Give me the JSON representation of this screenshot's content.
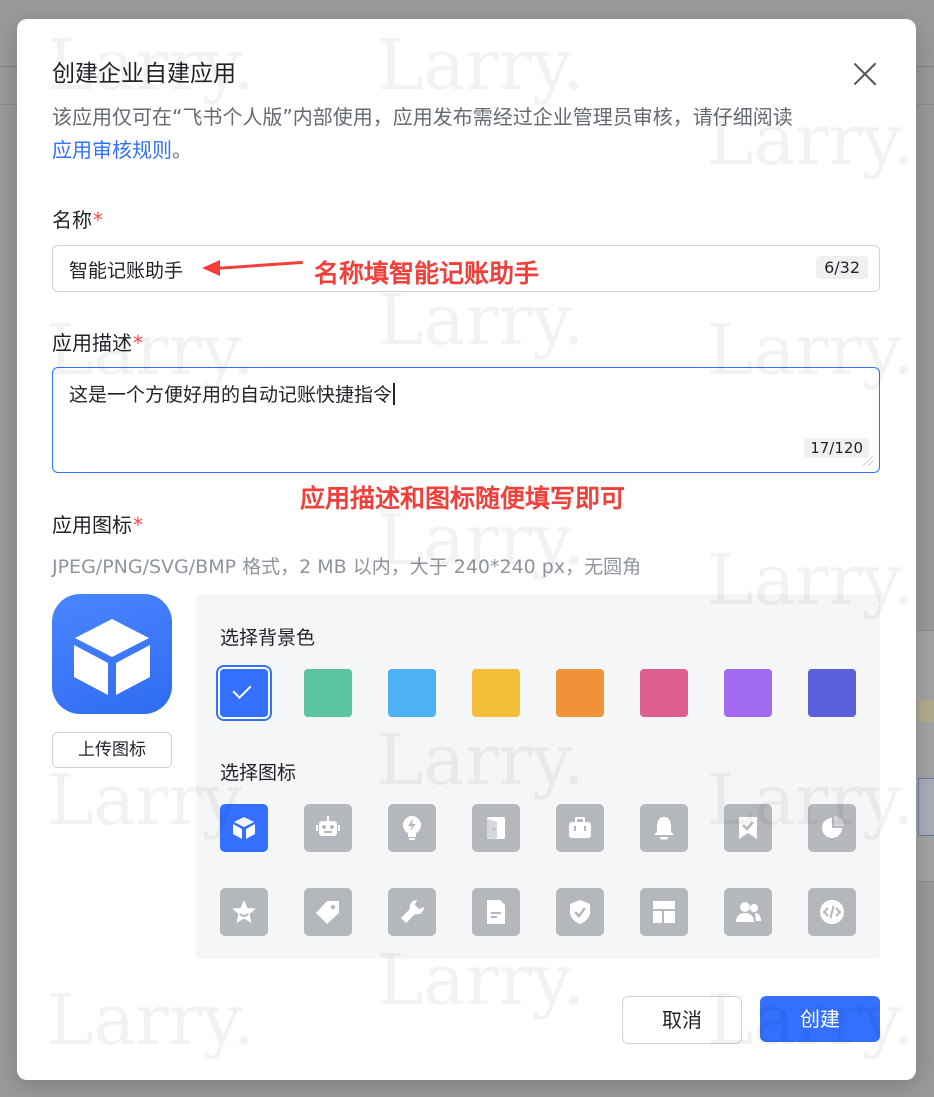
{
  "modal": {
    "title": "创建企业自建应用",
    "description": "该应用仅可在“飞书个人版”内部使用，应用发布需经过企业管理员审核，请仔细阅读",
    "rules_link": "应用审核规则",
    "rules_suffix": "。"
  },
  "form": {
    "required_mark": "*",
    "name": {
      "label": "名称",
      "value": "智能记账助手",
      "count": "6/32"
    },
    "description": {
      "label": "应用描述",
      "value": "这是一个方便好用的自动记账快捷指令",
      "count": "17/120"
    },
    "icon": {
      "label": "应用图标",
      "hint": "JPEG/PNG/SVG/BMP 格式，2 MB 以内，大于 240*240 px，无圆角",
      "upload_label": "上传图标",
      "bg_section_label": "选择背景色",
      "icon_section_label": "选择图标",
      "bg_colors": [
        "#3370ff",
        "#5bc4a0",
        "#4cb2f5",
        "#f5be3a",
        "#f0923a",
        "#de5f8f",
        "#a26af0",
        "#5b5fdb"
      ],
      "selected_bg_index": 0,
      "icons": [
        "cube-icon",
        "robot-icon",
        "lightbulb-icon",
        "door-icon",
        "briefcase-icon",
        "bell-icon",
        "bookmark-check-icon",
        "pie-chart-icon",
        "star-icon",
        "tag-icon",
        "wrench-icon",
        "document-icon",
        "shield-check-icon",
        "layout-icon",
        "users-icon",
        "code-icon"
      ],
      "selected_icon_index": 0
    }
  },
  "annotations": {
    "name_note": "名称填智能记账助手",
    "desc_note": "应用描述和图标随便填写即可"
  },
  "buttons": {
    "cancel": "取消",
    "create": "创建"
  },
  "watermark": "Larry."
}
